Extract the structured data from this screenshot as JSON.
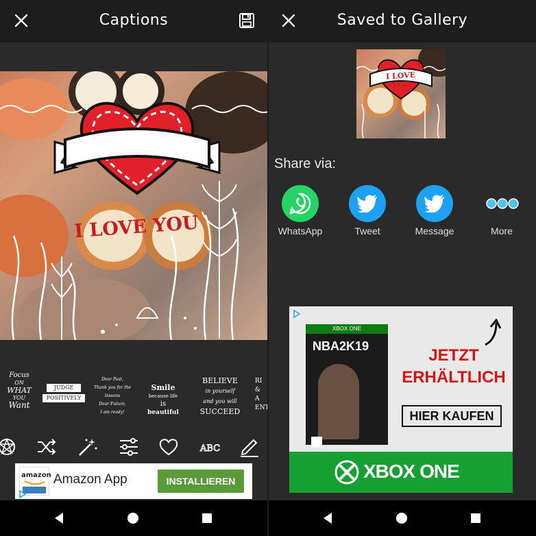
{
  "left": {
    "title": "Captions",
    "sticker_text": "I LOVE YOU",
    "stickers": [
      {
        "lines": [
          "Focus",
          "ON",
          "WHAT",
          "YOU",
          "Want"
        ]
      },
      {
        "lines": [
          "JUDGE",
          "POSITIVELY"
        ]
      },
      {
        "lines": [
          "Dear Past,",
          "Thank you for the lessons",
          "Dear Future,",
          "I am ready!"
        ]
      },
      {
        "lines": [
          "Smile",
          "because life",
          "is",
          "beautiful"
        ]
      },
      {
        "lines": [
          "BELIEVE",
          "in yourself",
          "and you will",
          "SUCCEED"
        ]
      },
      {
        "lines": [
          "RI",
          "&",
          "A",
          "ENT"
        ]
      }
    ],
    "tools": [
      "magic-icon",
      "shuffle-icon",
      "wand-icon",
      "sliders-icon",
      "heart-icon",
      "text-style-icon",
      "edit-icon"
    ],
    "ad": {
      "brand": "amazon",
      "name": "Amazon App",
      "button": "INSTALLIEREN"
    }
  },
  "right": {
    "title": "Saved to Gallery",
    "thumb_text": "I LOVE YOU",
    "share_title": "Share via:",
    "share": [
      {
        "label": "WhatsApp",
        "icon": "whatsapp-icon",
        "color": "#25d366"
      },
      {
        "label": "Tweet",
        "icon": "twitter-icon",
        "color": "#1da1f2"
      },
      {
        "label": "Message",
        "icon": "twitter-icon",
        "color": "#1da1f2"
      },
      {
        "label": "More",
        "icon": "more-icon",
        "color": "#4fc3f7"
      }
    ],
    "ad": {
      "cover_badge": "XBOX ONE",
      "cover_title": "NBA2K19",
      "headline_1": "JETZT",
      "headline_2": "ERHÄLTLICH",
      "cta": "HIER KAUFEN",
      "brand": "XBOX ONE"
    }
  },
  "colors": {
    "topbar": "#1d1d1d",
    "background": "#2a2a2a",
    "install": "#5b9a3a",
    "xbox_green": "#16a034",
    "heart_red": "#e2202a"
  }
}
